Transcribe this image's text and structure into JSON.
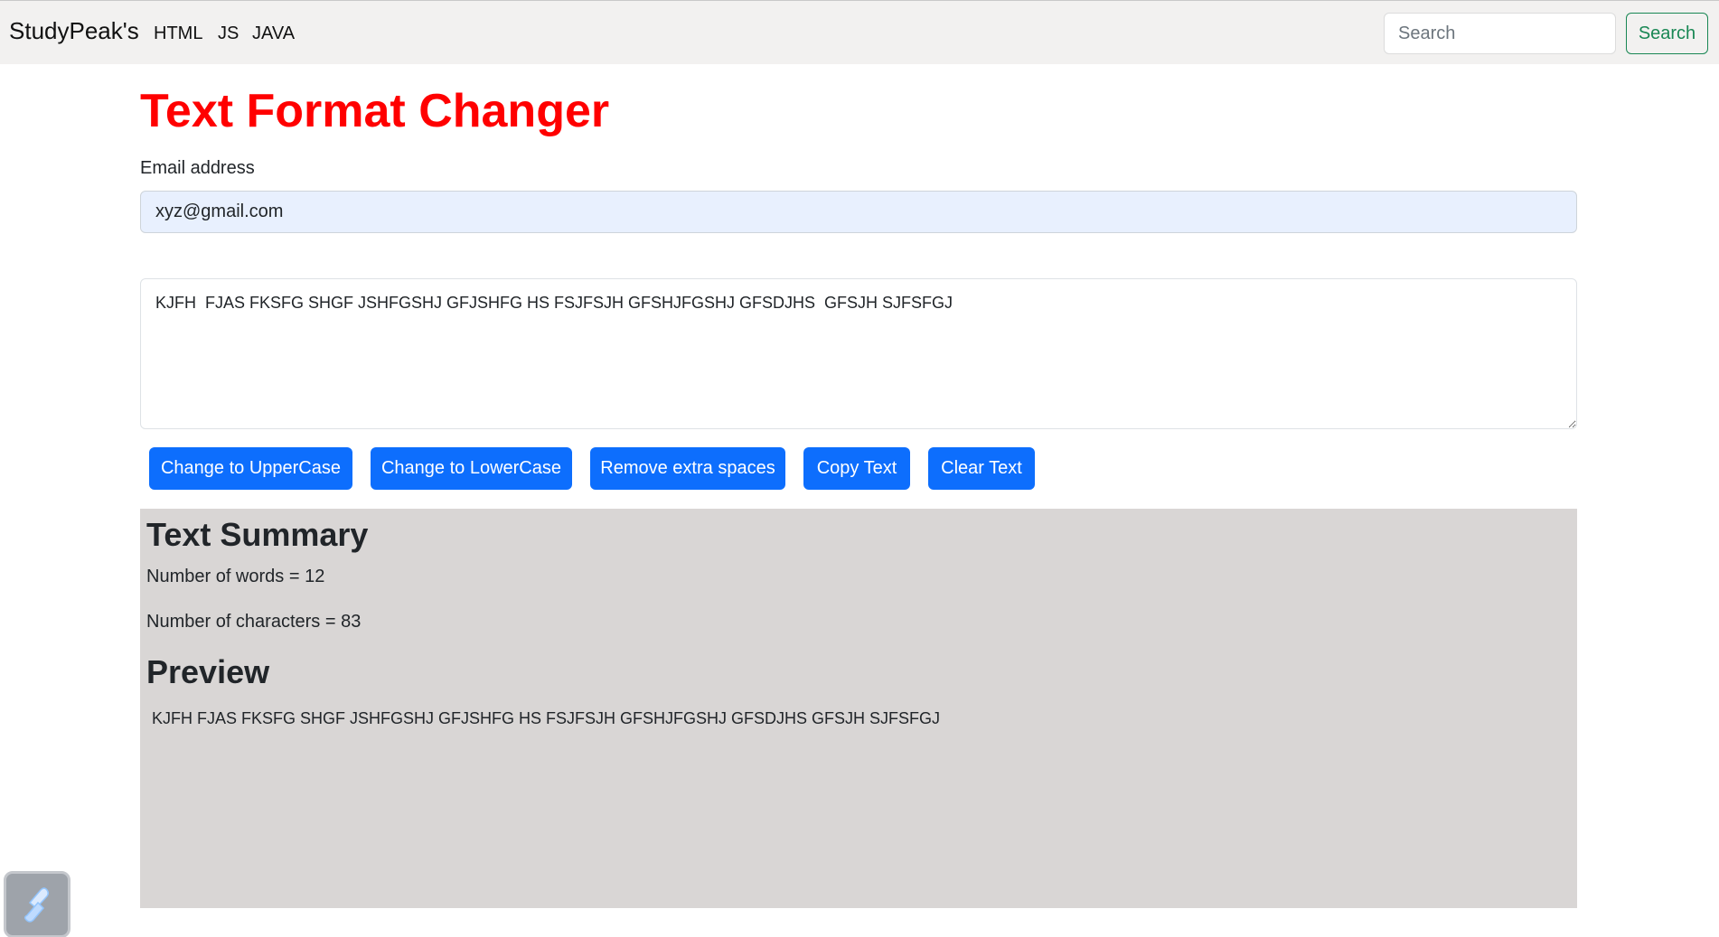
{
  "navbar": {
    "brand": "StudyPeak's",
    "links": [
      "HTML",
      "JS",
      "JAVA"
    ],
    "search_placeholder": "Search",
    "search_button": "Search"
  },
  "main": {
    "title": "Text Format Changer",
    "email_label": "Email address",
    "email_value": "xyz@gmail.com",
    "text_value": "KJFH  FJAS FKSFG SHGF JSHFGSHJ GFJSHFG HS FSJFSJH GFSHJFGSHJ GFSDJHS  GFSJH SJFSFGJ",
    "buttons": {
      "uppercase": "Change to UpperCase",
      "lowercase": "Change to LowerCase",
      "remove_spaces": "Remove extra spaces",
      "copy": "Copy Text",
      "clear": "Clear Text"
    }
  },
  "summary": {
    "title": "Text Summary",
    "words": "Number of words = 12",
    "characters": "Number of characters = 83",
    "preview_title": "Preview",
    "preview_text": "KJFH FJAS FKSFG SHGF JSHFGSHJ GFJSHFG HS FSJFSJH GFSHJFGSHJ GFSDJHS GFSJH SJFSFGJ"
  },
  "colors": {
    "title_red": "#ff0000",
    "button_blue": "#0d6efd",
    "search_green": "#198754",
    "navbar_bg": "#f2f1f0",
    "summary_bg": "#d9d6d5",
    "email_bg": "#e8f0fe"
  },
  "icons": {
    "floating": "app-launcher-icon"
  }
}
